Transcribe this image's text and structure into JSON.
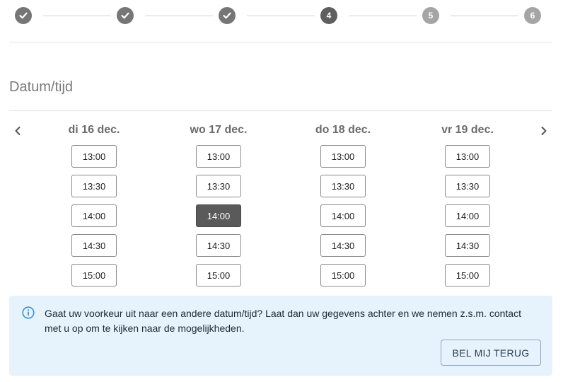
{
  "stepper": {
    "steps": [
      {
        "state": "done",
        "label": ""
      },
      {
        "state": "done",
        "label": ""
      },
      {
        "state": "done",
        "label": ""
      },
      {
        "state": "current",
        "label": "4"
      },
      {
        "state": "future",
        "label": "5"
      },
      {
        "state": "future",
        "label": "6"
      }
    ]
  },
  "section": {
    "title": "Datum/tijd"
  },
  "calendar": {
    "days": [
      {
        "label": "di 16 dec.",
        "slots": [
          "13:00",
          "13:30",
          "14:00",
          "14:30",
          "15:00"
        ]
      },
      {
        "label": "wo 17 dec.",
        "slots": [
          "13:00",
          "13:30",
          "14:00",
          "14:30",
          "15:00"
        ]
      },
      {
        "label": "do 18 dec.",
        "slots": [
          "13:00",
          "13:30",
          "14:00",
          "14:30",
          "15:00"
        ]
      },
      {
        "label": "vr 19 dec.",
        "slots": [
          "13:00",
          "13:30",
          "14:00",
          "14:30",
          "15:00"
        ]
      }
    ],
    "selected": {
      "day": 1,
      "slot": 2
    }
  },
  "info": {
    "text": "Gaat uw voorkeur uit naar een andere datum/tijd? Laat dan uw gegevens achter en we nemen z.s.m. contact met u op om te kijken naar de mogelijkheden.",
    "button_label": "BEL MIJ TERUG"
  },
  "colors": {
    "step_done": "#767676",
    "step_current": "#5f5f5f",
    "step_future": "#a5a5a5",
    "slot_selected": "#5a5a5a",
    "info_bg": "#e6f2fc",
    "info_icon": "#3a8fd6"
  }
}
